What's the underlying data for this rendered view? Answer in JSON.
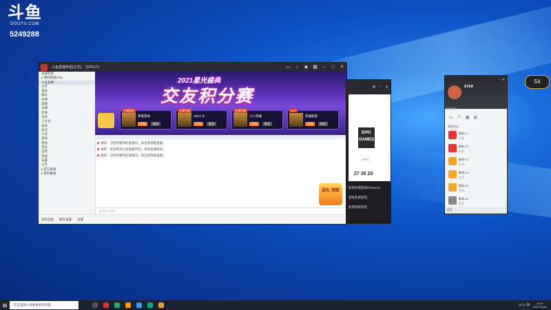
{
  "desktop": {
    "logo_text": "斗鱼",
    "logo_sub": "DOUYU.COM",
    "room_id": "5249288"
  },
  "main_window": {
    "title": "斗鱼直播伴侣(正式)",
    "title_num": "2970173",
    "sidebar": [
      "主播列表",
      "▸ 我的频道(4/6)",
      "  斗鱼直播",
      "  大厅",
      "  电竞",
      "  娱乐",
      "  手游",
      "  直播",
      "  主播",
      "  其他",
      "  主机",
      "  上大号",
      "  发现",
      "  生活",
      "  小说",
      "  美食",
      "  游戏",
      "  音乐",
      "  运营",
      "  其他",
      "  设置",
      "  公告",
      "▸ 官方频道",
      "▸ 我的群组"
    ],
    "banner_title1": "2021星光盛典",
    "banner_title2": "交友积分赛",
    "cards": [
      {
        "tag": "小猪佩奇",
        "name": "养猪游戏",
        "btn": "开始",
        "btn2": "取消"
      },
      {
        "tag": "主播专属",
        "name": "100人头",
        "btn": "开始",
        "btn2": "取消"
      },
      {
        "tag": "主播专属",
        "name": "小小英雄",
        "btn": "开始",
        "btn2": "取消"
      },
      {
        "tag": "DNF",
        "name": "英雄联盟",
        "btn": "开始",
        "btn2": "取消"
      }
    ],
    "chat": [
      "通知：已经开播你的直播间，请注意观看直播。",
      "通知：欢迎来到斗鱼直播伴侣，祝你直播愉快。",
      "通知：已经开播你的直播间，请注意观看直播。"
    ],
    "input_placeholder": "说点什么吧...",
    "bottom": [
      "语音连麦",
      "聊天设置",
      "设置"
    ],
    "gift": "送礼 领取"
  },
  "epic_window": {
    "logo": "EPIC GAMES",
    "label": "EPIC",
    "temps": "27 36 28",
    "news": [
      "获得免费游戏iPhone13",
      "领取免费游戏",
      "免费领取游戏"
    ]
  },
  "qq_panel": {
    "name": "STAR",
    "status": "在线",
    "search": "搜索联系人",
    "group": "我的好友",
    "rows": [
      {
        "nm": "联系人1",
        "sub": "在线"
      },
      {
        "nm": "联系人2",
        "sub": "在线"
      },
      {
        "nm": "联系人3",
        "sub": "在线"
      },
      {
        "nm": "联系人4",
        "sub": "在线"
      },
      {
        "nm": "联系人5",
        "sub": "在线"
      },
      {
        "nm": "联系人6",
        "sub": "在线"
      }
    ],
    "footer": "更多"
  },
  "badge": "54",
  "taskbar": {
    "search": "在这里输入你要搜索的内容",
    "weather": "22°C 晴",
    "time": "20:07",
    "date": "2021/10/16"
  }
}
